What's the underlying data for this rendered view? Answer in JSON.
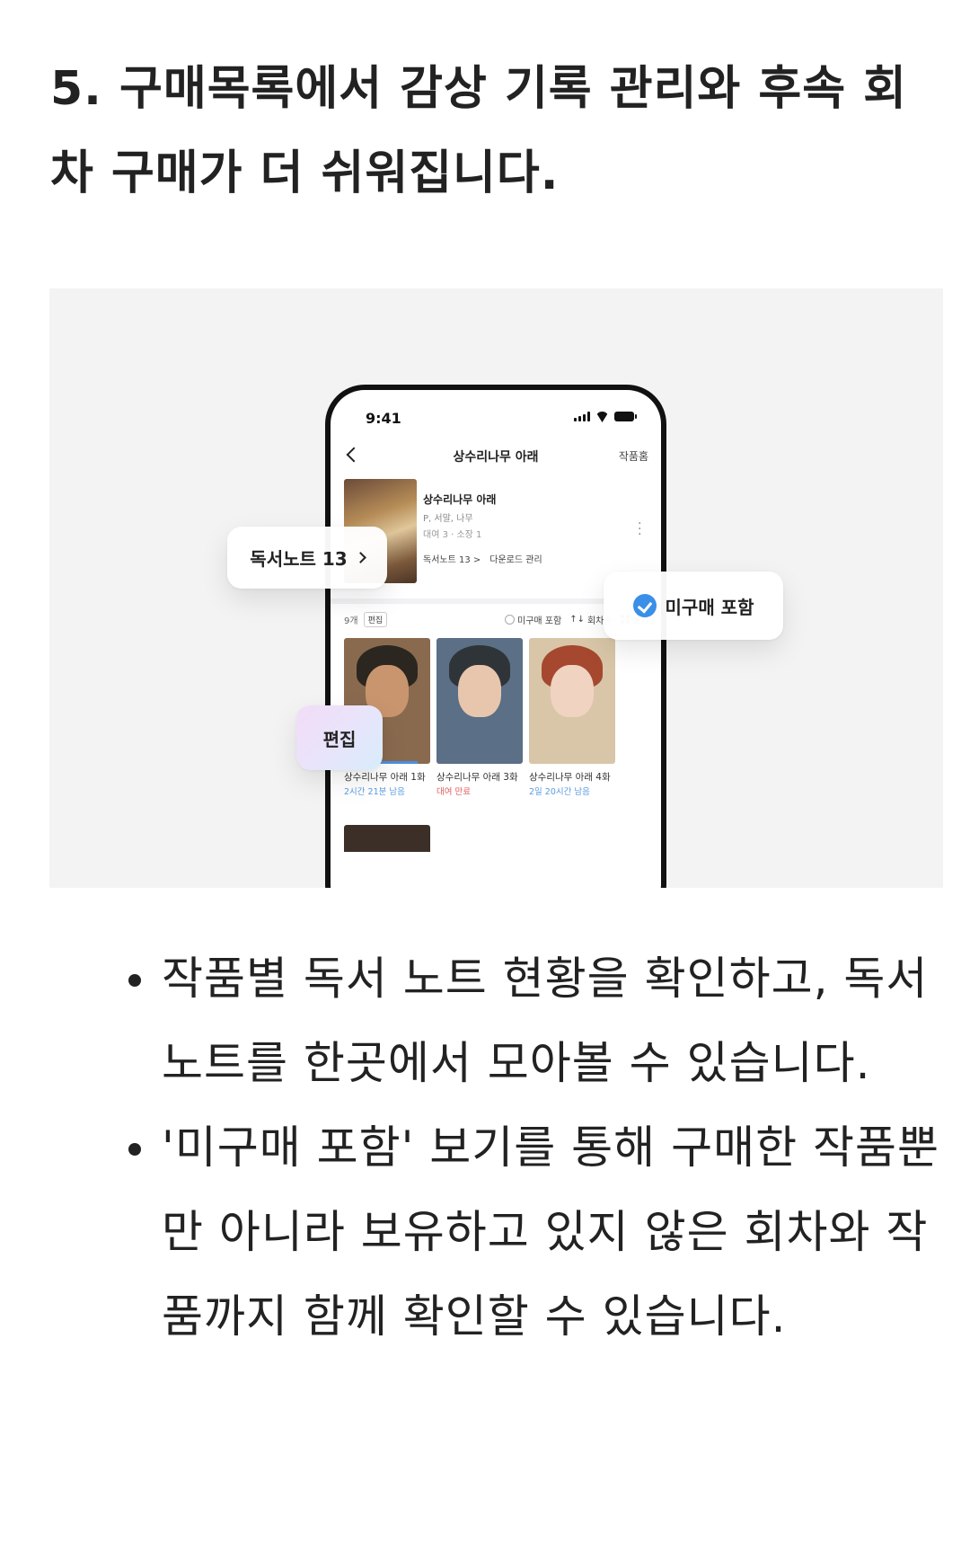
{
  "heading": "5. 구매목록에서 감상 기록 관리와 후속 회차 구매가 더 쉬워집니다.",
  "phone": {
    "status_time": "9:41",
    "nav_title": "상수리나무 아래",
    "nav_right": "작품홈",
    "work": {
      "title": "상수리나무 아래",
      "authors": "P, 서말, 나무",
      "counts": "대여 3 · 소장 1",
      "reading_note_link": "독서노트 13 >",
      "download_link": "다운로드 관리"
    },
    "toolbar": {
      "count": "9개",
      "edit": "편집",
      "include_unpurchased": "미구매 포함",
      "sort": "회차순",
      "view": "보기"
    },
    "episodes": [
      {
        "title": "상수리나무 아래 1화",
        "status": "2시간 21분 남음",
        "status_color": "#5a9be0",
        "progress": 0.85,
        "skin": "#c9956e",
        "hair": "#2b2620",
        "bg": "#8a6a4f"
      },
      {
        "title": "상수리나무 아래 3화",
        "status": "대여 만료",
        "status_color": "#e05a5a",
        "progress": 0,
        "skin": "#e8c6ad",
        "hair": "#2f3438",
        "bg": "#5b6f86"
      },
      {
        "title": "상수리나무 아래 4화",
        "status": "2일 20시간 남음",
        "status_color": "#5a9be0",
        "progress": 0,
        "skin": "#f1d3c2",
        "hair": "#a5482f",
        "bg": "#d9c6a8"
      }
    ]
  },
  "floating": {
    "reading_note": "독서노트 13",
    "unpurchased": "미구매 포함",
    "edit": "편집"
  },
  "bullets": [
    "작품별 독서 노트 현황을 확인하고, 독서 노트를 한곳에서 모아볼 수 있습니다.",
    "'미구매 포함' 보기를 통해 구매한 작품뿐만 아니라 보유하고 있지 않은 회차와 작품까지 함께 확인할 수 있습니다."
  ],
  "colors": {
    "accent_blue": "#3a8fe8",
    "expired_red": "#e05a5a",
    "illustration_bg": "#f3f3f4"
  }
}
